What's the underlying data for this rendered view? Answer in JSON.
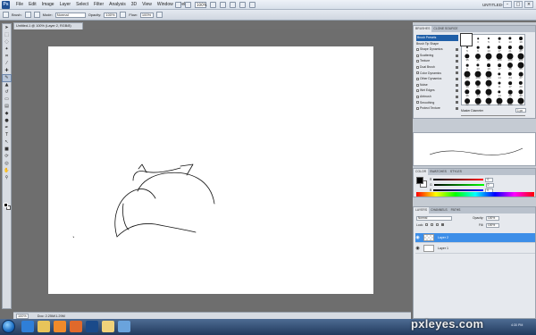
{
  "menubar": {
    "logo": "Ps",
    "menus": [
      "File",
      "Edit",
      "Image",
      "Layer",
      "Select",
      "Filter",
      "Analysis",
      "3D",
      "View",
      "Window",
      "Help"
    ],
    "zoom": "100%",
    "workspace": "UNTITLED-1",
    "window_buttons": [
      "–",
      "□",
      "×"
    ]
  },
  "options_bar": {
    "tool": "Brush:",
    "mode_label": "Mode:",
    "mode_value": "Normal",
    "opacity_label": "Opacity:",
    "opacity_value": "100%",
    "flow_label": "Flow:",
    "flow_value": "100%"
  },
  "document": {
    "tab_title": "Untitled-1 @ 100% (Layer 2, RGB/8)",
    "status_zoom": "100%",
    "status_doc": "Doc: 2.25M/1.29M"
  },
  "brushes_panel": {
    "tabs": [
      "BRUSHES",
      "CLONE SOURCE"
    ],
    "options": [
      {
        "label": "Brush Presets",
        "checkbox": false,
        "lock": false,
        "active": true
      },
      {
        "label": "Brush Tip Shape",
        "checkbox": false,
        "lock": false,
        "active": false
      },
      {
        "label": "Shape Dynamics",
        "checkbox": true,
        "lock": true,
        "active": false
      },
      {
        "label": "Scattering",
        "checkbox": true,
        "lock": true,
        "active": false
      },
      {
        "label": "Texture",
        "checkbox": true,
        "lock": true,
        "active": false
      },
      {
        "label": "Dual Brush",
        "checkbox": true,
        "lock": true,
        "active": false
      },
      {
        "label": "Color Dynamics",
        "checkbox": true,
        "lock": true,
        "active": false
      },
      {
        "label": "Other Dynamics",
        "checkbox": true,
        "lock": true,
        "active": false
      },
      {
        "label": "Noise",
        "checkbox": true,
        "lock": true,
        "active": false
      },
      {
        "label": "Wet Edges",
        "checkbox": true,
        "lock": true,
        "active": false
      },
      {
        "label": "Airbrush",
        "checkbox": true,
        "lock": true,
        "active": false
      },
      {
        "label": "Smoothing",
        "checkbox": true,
        "lock": true,
        "active": false
      },
      {
        "label": "Protect Texture",
        "checkbox": true,
        "lock": true,
        "active": false
      }
    ],
    "brush_sizes": [
      1,
      3,
      5,
      9,
      13,
      19,
      5,
      9,
      13,
      17,
      21,
      27,
      35,
      45,
      65,
      100,
      200,
      300,
      9,
      13,
      19,
      17,
      45,
      65,
      100,
      200,
      300,
      14,
      24,
      27,
      39,
      46,
      59,
      11,
      17,
      23,
      36,
      44,
      60,
      14,
      26,
      33,
      42,
      55,
      70,
      112,
      134,
      74
    ],
    "master_diameter_label": "Master Diameter",
    "master_diameter_value": "1 px"
  },
  "color_panel": {
    "tabs": [
      "COLOR",
      "SWATCHES",
      "STYLES"
    ],
    "fg": "#000000",
    "bg": "#ffffff",
    "channels": [
      {
        "label": "R",
        "value": "0"
      },
      {
        "label": "G",
        "value": "0"
      },
      {
        "label": "B",
        "value": "0"
      }
    ]
  },
  "layers_panel": {
    "tabs": [
      "LAYERS",
      "CHANNELS",
      "PATHS"
    ],
    "blend_mode": "Normal",
    "opacity_label": "Opacity:",
    "opacity_value": "100%",
    "lock_label": "Lock:",
    "fill_label": "Fill:",
    "fill_value": "100%",
    "layers": [
      {
        "name": "Layer 2",
        "active": true
      },
      {
        "name": "Layer 1",
        "active": false
      }
    ]
  },
  "taskbar": {
    "watermark": "pxleyes.com",
    "clock": "4:30 PM",
    "icons": [
      {
        "name": "ie",
        "color": "#2f7fd8"
      },
      {
        "name": "folder",
        "color": "#e8c45a"
      },
      {
        "name": "media",
        "color": "#f08a2a"
      },
      {
        "name": "firefox",
        "color": "#e0692b"
      },
      {
        "name": "photoshop",
        "color": "#1a4a8a"
      },
      {
        "name": "explorer",
        "color": "#f0d27a"
      },
      {
        "name": "app",
        "color": "#6aa3dc"
      }
    ]
  }
}
